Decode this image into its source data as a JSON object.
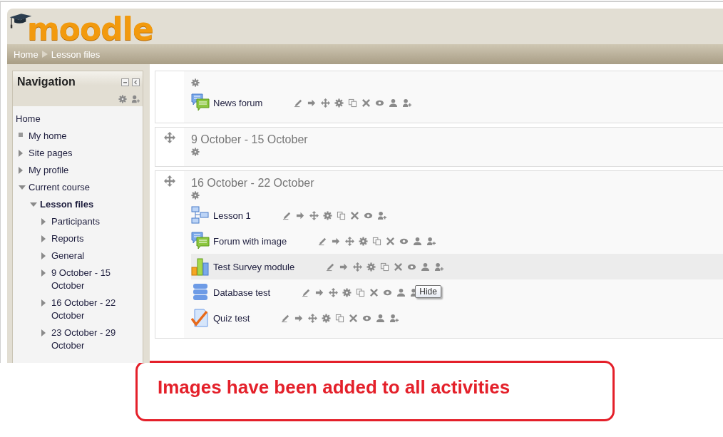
{
  "header": {
    "logo": "moodle"
  },
  "breadcrumb": [
    "Home",
    "Lesson files"
  ],
  "navigation": {
    "title": "Navigation",
    "items": [
      {
        "label": "Home",
        "kind": "root"
      },
      {
        "label": "My home",
        "kind": "leaf"
      },
      {
        "label": "Site pages",
        "kind": "branch",
        "expanded": false
      },
      {
        "label": "My profile",
        "kind": "branch",
        "expanded": false
      },
      {
        "label": "Current course",
        "kind": "branch",
        "expanded": true,
        "children": [
          {
            "label": "Lesson files",
            "kind": "branch",
            "expanded": true,
            "current": true,
            "children": [
              {
                "label": "Participants",
                "kind": "branch",
                "expanded": false
              },
              {
                "label": "Reports",
                "kind": "branch",
                "expanded": false
              },
              {
                "label": "General",
                "kind": "branch",
                "expanded": false
              },
              {
                "label": "9 October - 15 October",
                "kind": "branch",
                "expanded": false
              },
              {
                "label": "16 October - 22 October",
                "kind": "branch",
                "expanded": false
              },
              {
                "label": "23 October - 29 October",
                "kind": "branch",
                "expanded": false
              }
            ]
          }
        ]
      }
    ]
  },
  "sections": [
    {
      "movable": false,
      "activities": [
        {
          "kind": "forum",
          "label": "News forum",
          "highlighted": false,
          "actions": [
            {
              "kind": "edit"
            },
            {
              "kind": "indent"
            },
            {
              "kind": "move"
            },
            {
              "kind": "settings"
            },
            {
              "kind": "duplicate"
            },
            {
              "kind": "delete"
            },
            {
              "kind": "eye"
            },
            {
              "kind": "group"
            },
            {
              "kind": "assign"
            }
          ]
        }
      ]
    },
    {
      "movable": true,
      "title": "9 October - 15 October"
    },
    {
      "movable": true,
      "title": "16 October - 22 October",
      "activities": [
        {
          "kind": "lesson",
          "label": "Lesson 1",
          "highlighted": false,
          "actions": [
            {
              "kind": "edit"
            },
            {
              "kind": "indent"
            },
            {
              "kind": "move"
            },
            {
              "kind": "settings"
            },
            {
              "kind": "duplicate"
            },
            {
              "kind": "delete"
            },
            {
              "kind": "eye"
            },
            {
              "kind": "assign"
            }
          ]
        },
        {
          "kind": "forum",
          "label": "Forum with image",
          "highlighted": false,
          "actions": [
            {
              "kind": "edit"
            },
            {
              "kind": "indent"
            },
            {
              "kind": "move"
            },
            {
              "kind": "settings"
            },
            {
              "kind": "duplicate"
            },
            {
              "kind": "delete"
            },
            {
              "kind": "eye"
            },
            {
              "kind": "group"
            },
            {
              "kind": "assign"
            }
          ]
        },
        {
          "kind": "survey",
          "label": "Test Survey module",
          "highlighted": true,
          "actions": [
            {
              "kind": "edit"
            },
            {
              "kind": "indent"
            },
            {
              "kind": "move"
            },
            {
              "kind": "settings"
            },
            {
              "kind": "duplicate"
            },
            {
              "kind": "delete"
            },
            {
              "kind": "eye"
            },
            {
              "kind": "group"
            },
            {
              "kind": "assign"
            }
          ]
        },
        {
          "kind": "database",
          "label": "Database test",
          "highlighted": false,
          "tooltip": "Hide",
          "actions": [
            {
              "kind": "edit"
            },
            {
              "kind": "indent"
            },
            {
              "kind": "move"
            },
            {
              "kind": "settings"
            },
            {
              "kind": "duplicate"
            },
            {
              "kind": "delete"
            },
            {
              "kind": "eye"
            },
            {
              "kind": "group"
            },
            {
              "kind": "assign"
            }
          ]
        },
        {
          "kind": "quiz",
          "label": "Quiz test",
          "highlighted": false,
          "actions": [
            {
              "kind": "edit"
            },
            {
              "kind": "indent"
            },
            {
              "kind": "move"
            },
            {
              "kind": "settings"
            },
            {
              "kind": "duplicate"
            },
            {
              "kind": "delete"
            },
            {
              "kind": "eye"
            },
            {
              "kind": "group"
            },
            {
              "kind": "assign"
            }
          ]
        }
      ]
    }
  ],
  "callout": "Images have been added to all activities"
}
